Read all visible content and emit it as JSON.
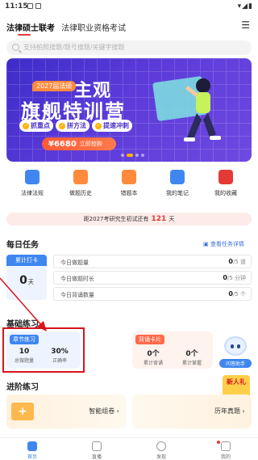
{
  "status": {
    "time": "11:15"
  },
  "topnav": {
    "tabs": [
      "法律硕士联考",
      "法律职业资格考试"
    ],
    "menu_icon": "hamburger-icon"
  },
  "search": {
    "placeholder": "支持拍照搜题/题号搜题/关键字搜题"
  },
  "banner": {
    "tag": "2027届法硕",
    "line1": "主观",
    "line2": "旗舰特训营",
    "pills": [
      "抓重点",
      "拼方法",
      "提速冲刺"
    ],
    "price": "¥6680",
    "cta": "立即抢购",
    "colors": {
      "bg": "#4a2fc8",
      "accent": "#ffb300",
      "price": "#ff5a36"
    }
  },
  "quick": [
    {
      "label": "法律法规",
      "icon": "law-book-icon",
      "color": "#3f86f0"
    },
    {
      "label": "做题历史",
      "icon": "history-icon",
      "color": "#ff8a3d"
    },
    {
      "label": "错题本",
      "icon": "wrong-book-icon",
      "color": "#ff8a3d"
    },
    {
      "label": "我的笔记",
      "icon": "notes-icon",
      "color": "#3f86f0"
    },
    {
      "label": "我的收藏",
      "icon": "star-icon",
      "color": "#e53935"
    }
  ],
  "countdown": {
    "prefix": "距2027考研究生初试还有",
    "days": "121",
    "suffix": "天"
  },
  "daily": {
    "title": "每日任务",
    "link": "查看任务详情",
    "streak_label": "累计打卡",
    "streak_value": "0",
    "streak_unit": "天",
    "rows": [
      {
        "label": "今日做题量",
        "done": "0",
        "total": "/5 道"
      },
      {
        "label": "今日做题时长",
        "done": "0",
        "total": "/5 分钟"
      },
      {
        "label": "今日背诵数量",
        "done": "0",
        "total": "/5 个"
      }
    ]
  },
  "basic": {
    "title": "基础练习",
    "chapter": {
      "tag": "章节练习",
      "count": "10",
      "count_label": "总做题量",
      "rate": "30%",
      "rate_label": "正确率"
    },
    "recite": {
      "tag": "背诵卡片",
      "a": "0个",
      "a_label": "累计背诵",
      "b": "0个",
      "b_label": "累计掌握"
    },
    "assistant": "问答助手"
  },
  "advanced": {
    "title": "进阶练习",
    "left": "智能组卷",
    "right": "历年真题",
    "gift": "新人礼"
  },
  "tabbar": [
    "首页",
    "直播",
    "发现",
    "我的"
  ]
}
